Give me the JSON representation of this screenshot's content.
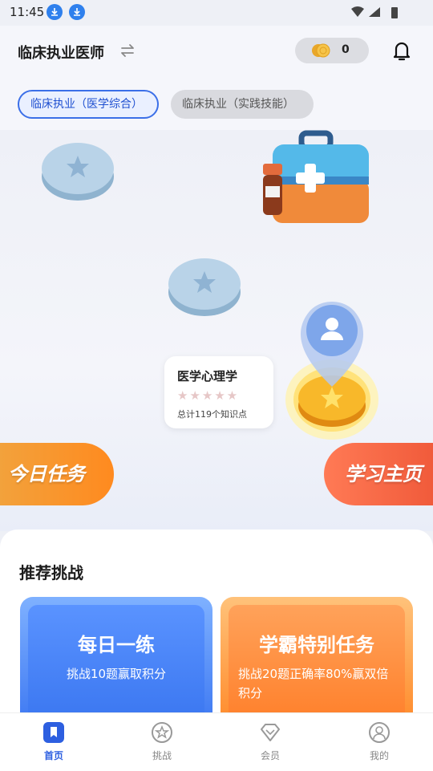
{
  "status": {
    "time": "11:45"
  },
  "header": {
    "title": "临床执业医师",
    "coins": "0",
    "tabs": [
      {
        "label": "临床执业（医学综合）",
        "active": true
      },
      {
        "label": "临床执业（实践技能）",
        "active": false
      }
    ]
  },
  "map": {
    "card": {
      "title": "医学心理学",
      "stars": "★★★★★",
      "subtitle": "总计119个知识点"
    },
    "left_banner": "今日任务",
    "right_banner": "学习主页"
  },
  "recommend": {
    "title": "推荐挑战",
    "cards": [
      {
        "title": "每日一练",
        "subtitle": "挑战10题赢取积分"
      },
      {
        "title": "学霸特别任务",
        "subtitle": "挑战20题正确率80%赢双倍积分"
      }
    ]
  },
  "nav": {
    "items": [
      {
        "label": "首页",
        "icon": "bookmark-icon"
      },
      {
        "label": "挑战",
        "icon": "star-circle-icon"
      },
      {
        "label": "会员",
        "icon": "diamond-icon"
      },
      {
        "label": "我的",
        "icon": "user-icon"
      }
    ]
  },
  "colors": {
    "accent": "#2d5fe0",
    "orange": "#ff8a1f",
    "coral": "#f05a3a"
  }
}
